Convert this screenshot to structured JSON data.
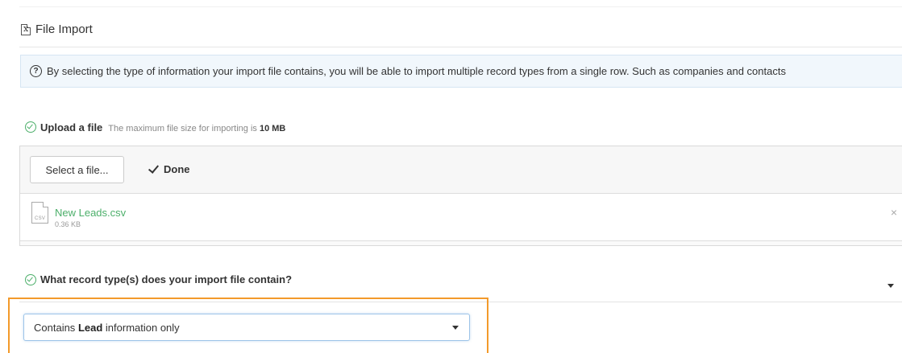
{
  "header": {
    "title": "File Import",
    "icon": "excel-file-icon"
  },
  "info": {
    "icon": "question-circle-icon",
    "text": "By selecting the type of information your import file contains, you will be able to import multiple record types from a single row. Such as companies and contacts"
  },
  "upload": {
    "title": "Upload a file",
    "hint_prefix": "The maximum file size for importing is",
    "hint_value": "10 MB",
    "select_button": "Select a file...",
    "status": "Done",
    "file": {
      "name": "New Leads.csv",
      "size": "0.36 KB",
      "type_label": "CSV"
    },
    "remove_symbol": "×"
  },
  "record_type": {
    "title": "What record type(s) does your import file contain?",
    "selected_prefix": "Contains",
    "selected_bold": "Lead",
    "selected_suffix": "information only"
  },
  "colors": {
    "accent_green": "#4caf6a",
    "highlight_orange": "#f39a2b",
    "info_background": "#f1f7fc"
  }
}
